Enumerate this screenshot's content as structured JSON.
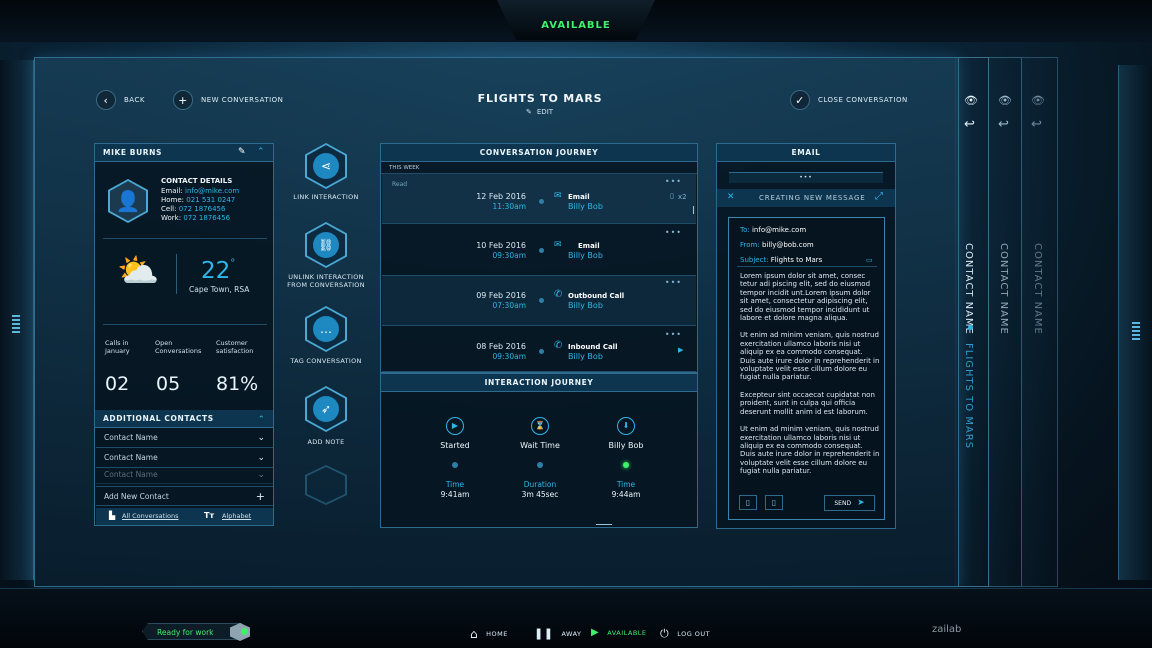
{
  "status_bar": {
    "current_status": "AVAILABLE"
  },
  "header": {
    "back_label": "BACK",
    "new_conversation_label": "NEW CONVERSATION",
    "title": "FLIGHTS TO MARS",
    "edit_label": "EDIT",
    "close_conversation_label": "CLOSE CONVERSATION"
  },
  "contact_card": {
    "name": "MIKE BURNS",
    "details_title": "CONTACT DETAILS",
    "email_label": "Email:",
    "email": "info@mike.com",
    "home_label": "Home:",
    "home": "021 531 0247",
    "cell_label": "Cell:",
    "cell": "072 1876456",
    "work_label": "Work:",
    "work": "072 1876456",
    "weather": {
      "temp": "22",
      "unit": "°",
      "location": "Cape Town, RSA"
    },
    "stats": [
      {
        "label": "Calls in January",
        "value": "02"
      },
      {
        "label": "Open Conversations",
        "value": "05"
      },
      {
        "label": "Customer satisfaction",
        "value": "81%"
      }
    ],
    "additional_contacts_title": "ADDITIONAL CONTACTS",
    "contacts": [
      "Contact Name",
      "Contact Name",
      "Contact Name"
    ],
    "add_new_contact": "Add New Contact",
    "footer_all": "All Conversations",
    "footer_alpha": "Alphabet"
  },
  "actions": [
    {
      "label": "LINK INTERACTION",
      "icon": "share-icon"
    },
    {
      "label": "UNLINK INTERACTION FROM CONVERSATION",
      "icon": "unlink-icon"
    },
    {
      "label": "TAG CONVERSATION",
      "icon": "chat-icon"
    },
    {
      "label": "ADD NOTE",
      "icon": "rocket-icon"
    }
  ],
  "conversation_journey": {
    "title": "CONVERSATION JOURNEY",
    "section": "THIS WEEK",
    "read_label": "Read",
    "items": [
      {
        "date": "12 Feb 2016",
        "time": "11:30am",
        "type": "Email",
        "who": "Billy Bob",
        "count": "x2"
      },
      {
        "date": "10 Feb 2016",
        "time": "09:30am",
        "type": "Email",
        "who": "Billy Bob"
      },
      {
        "date": "09 Feb 2016",
        "time": "07:30am",
        "type": "Outbound Call",
        "who": "Billy Bob"
      },
      {
        "date": "08 Feb 2016",
        "time": "09:30am",
        "type": "Inbound Call",
        "who": "Billy Bob"
      }
    ]
  },
  "interaction_journey": {
    "title": "INTERACTION JOURNEY",
    "steps": [
      {
        "label": "Started",
        "meta_label": "Time",
        "meta_value": "9:41am"
      },
      {
        "label": "Wait Time",
        "meta_label": "Duration",
        "meta_value": "3m 45sec"
      },
      {
        "label": "Billy Bob",
        "meta_label": "Time",
        "meta_value": "9:44am"
      }
    ]
  },
  "email_panel": {
    "title": "EMAIL",
    "compose_title": "CREATING NEW MESSAGE",
    "to_label": "To:",
    "to": "info@mike.com",
    "from_label": "From:",
    "from": "billy@bob.com",
    "subject_label": "Subject:",
    "subject": "Flights to Mars",
    "body": [
      "Lorem ipsum dolor sit amet, consec tetur adi piscing elit, sed do eiusmod tempor incidit unt.Lorem ipsum dolor sit amet, consectetur adipiscing elit, sed do eiusmod tempor incididunt ut labore et dolore magna aliqua.",
      "Ut enim ad minim veniam, quis nostrud exercitation ullamco laboris nisi ut aliquip ex ea commodo consequat. Duis aute irure dolor in reprehenderit in voluptate velit esse cillum dolore eu fugiat nulla pariatur.",
      "Excepteur sint occaecat cupidatat non proident, sunt in culpa qui officia deserunt mollit anim id est laborum.",
      "Ut enim ad minim veniam, quis nostrud exercitation ullamco laboris nisi ut aliquip ex ea commodo consequat. Duis aute irure dolor in reprehenderit in voluptate velit esse cillum dolore eu fugiat nulla pariatur."
    ],
    "send_label": "SEND"
  },
  "side_cards": [
    {
      "name": "CONTACT NAME",
      "subtitle": "FLIGHTS TO MARS"
    },
    {
      "name": "CONTACT NAME"
    },
    {
      "name": "CONTACT NAME"
    }
  ],
  "bottom_bar": {
    "ready_label": "Ready for work",
    "nav": [
      "HOME",
      "AWAY",
      "AVAILABLE",
      "LOG OUT"
    ],
    "brand": "zailab"
  },
  "colors": {
    "accent": "#2eb6e8",
    "available": "#3ff06a",
    "panel": "#0e3550"
  }
}
